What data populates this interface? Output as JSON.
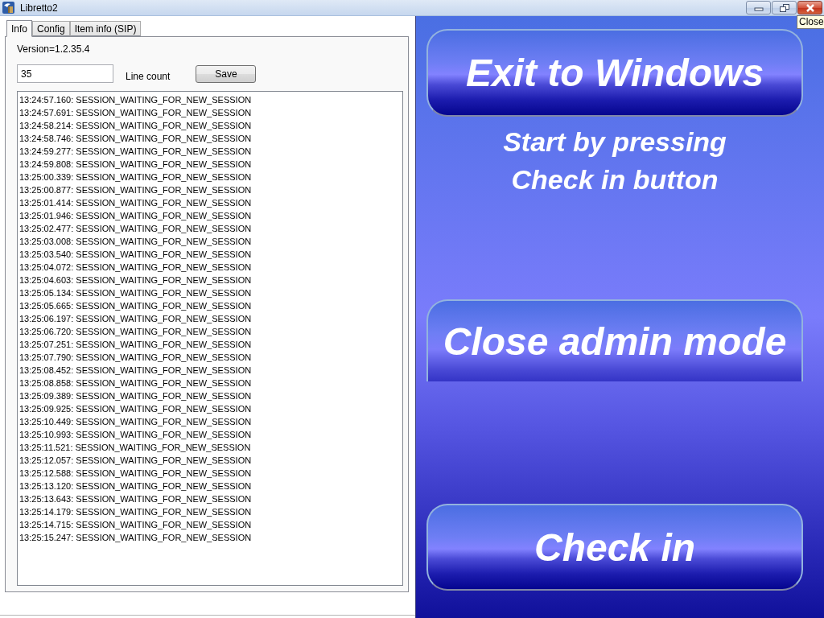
{
  "window": {
    "title": "Libretto2",
    "tooltip": "Close"
  },
  "tabs": [
    {
      "label": "Info",
      "selected": true
    },
    {
      "label": "Config",
      "selected": false
    },
    {
      "label": "Item info (SIP)",
      "selected": false
    }
  ],
  "info": {
    "version": "Version=1.2.35.4",
    "line_count": {
      "value": "35",
      "label": "Line count"
    },
    "save_button": "Save",
    "log_lines": [
      "13:24:57.160: SESSION_WAITING_FOR_NEW_SESSION",
      "13:24:57.691: SESSION_WAITING_FOR_NEW_SESSION",
      "13:24:58.214: SESSION_WAITING_FOR_NEW_SESSION",
      "13:24:58.746: SESSION_WAITING_FOR_NEW_SESSION",
      "13:24:59.277: SESSION_WAITING_FOR_NEW_SESSION",
      "13:24:59.808: SESSION_WAITING_FOR_NEW_SESSION",
      "13:25:00.339: SESSION_WAITING_FOR_NEW_SESSION",
      "13:25:00.877: SESSION_WAITING_FOR_NEW_SESSION",
      "13:25:01.414: SESSION_WAITING_FOR_NEW_SESSION",
      "13:25:01.946: SESSION_WAITING_FOR_NEW_SESSION",
      "13:25:02.477: SESSION_WAITING_FOR_NEW_SESSION",
      "13:25:03.008: SESSION_WAITING_FOR_NEW_SESSION",
      "13:25:03.540: SESSION_WAITING_FOR_NEW_SESSION",
      "13:25:04.072: SESSION_WAITING_FOR_NEW_SESSION",
      "13:25:04.603: SESSION_WAITING_FOR_NEW_SESSION",
      "13:25:05.134: SESSION_WAITING_FOR_NEW_SESSION",
      "13:25:05.665: SESSION_WAITING_FOR_NEW_SESSION",
      "13:25:06.197: SESSION_WAITING_FOR_NEW_SESSION",
      "13:25:06.720: SESSION_WAITING_FOR_NEW_SESSION",
      "13:25:07.251: SESSION_WAITING_FOR_NEW_SESSION",
      "13:25:07.790: SESSION_WAITING_FOR_NEW_SESSION",
      "13:25:08.452: SESSION_WAITING_FOR_NEW_SESSION",
      "13:25:08.858: SESSION_WAITING_FOR_NEW_SESSION",
      "13:25:09.389: SESSION_WAITING_FOR_NEW_SESSION",
      "13:25:09.925: SESSION_WAITING_FOR_NEW_SESSION",
      "13:25:10.449: SESSION_WAITING_FOR_NEW_SESSION",
      "13:25:10.993: SESSION_WAITING_FOR_NEW_SESSION",
      "13:25:11.521: SESSION_WAITING_FOR_NEW_SESSION",
      "13:25:12.057: SESSION_WAITING_FOR_NEW_SESSION",
      "13:25:12.588: SESSION_WAITING_FOR_NEW_SESSION",
      "13:25:13.120: SESSION_WAITING_FOR_NEW_SESSION",
      "13:25:13.643: SESSION_WAITING_FOR_NEW_SESSION",
      "13:25:14.179: SESSION_WAITING_FOR_NEW_SESSION",
      "13:25:14.715: SESSION_WAITING_FOR_NEW_SESSION",
      "13:25:15.247: SESSION_WAITING_FOR_NEW_SESSION"
    ]
  },
  "actions": {
    "exit_button": "Exit to Windows",
    "instruction": [
      "Start by pressing",
      "Check in button"
    ],
    "admin_button": "Close admin mode",
    "checkin_button": "Check in"
  }
}
